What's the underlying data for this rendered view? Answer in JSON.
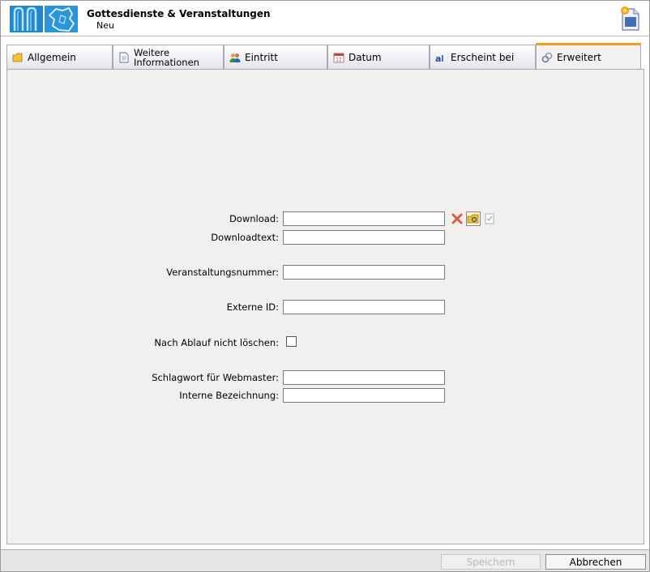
{
  "header": {
    "title": "Gottesdienste & Veranstaltungen",
    "subtitle": "Neu"
  },
  "tabs": [
    {
      "label": "Allgemein",
      "icon": "folder-icon",
      "active": false
    },
    {
      "label": "Weitere",
      "label2": "Informationen",
      "icon": "document-icon",
      "active": false
    },
    {
      "label": "Eintritt",
      "icon": "people-icon",
      "active": false
    },
    {
      "label": "Datum",
      "icon": "calendar-icon",
      "active": false
    },
    {
      "label": "Erscheint bei",
      "icon": "letters-icon",
      "active": false
    },
    {
      "label": "Erweitert",
      "icon": "gear-link-icon",
      "active": true
    }
  ],
  "form": {
    "download_label": "Download:",
    "download_value": "",
    "downloadtext_label": "Downloadtext:",
    "downloadtext_value": "",
    "veranstaltungsnummer_label": "Veranstaltungsnummer:",
    "veranstaltungsnummer_value": "",
    "externe_id_label": "Externe ID:",
    "externe_id_value": "",
    "nach_ablauf_label": "Nach Ablauf nicht löschen:",
    "nach_ablauf_checked": false,
    "schlagwort_label": "Schlagwort für Webmaster:",
    "schlagwort_value": "",
    "interne_label": "Interne Bezeichnung:",
    "interne_value": ""
  },
  "footer": {
    "save_label": "Speichern",
    "cancel_label": "Abbrechen"
  },
  "colors": {
    "accent_tab": "#f0a020",
    "logo_blue": "#1f88d0",
    "content_bg": "#f2f0ef"
  }
}
